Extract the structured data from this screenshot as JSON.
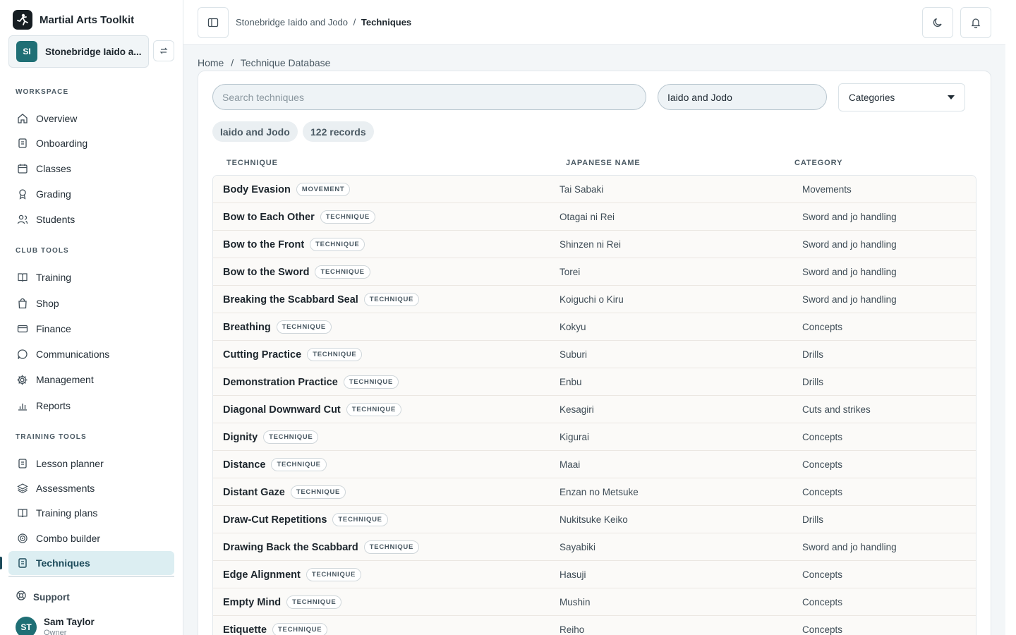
{
  "app": {
    "title": "Martial Arts Toolkit"
  },
  "club": {
    "initials": "SI",
    "name": "Stonebridge Iaido a..."
  },
  "sidebar": {
    "sections": {
      "workspace": "WORKSPACE",
      "club_tools": "CLUB TOOLS",
      "training_tools": "TRAINING TOOLS"
    },
    "workspace_items": [
      {
        "label": "Overview",
        "icon": "home-icon"
      },
      {
        "label": "Onboarding",
        "icon": "clipboard-icon"
      },
      {
        "label": "Classes",
        "icon": "calendar-icon"
      },
      {
        "label": "Grading",
        "icon": "award-icon"
      },
      {
        "label": "Students",
        "icon": "users-icon"
      }
    ],
    "club_items": [
      {
        "label": "Training",
        "icon": "book-icon"
      },
      {
        "label": "Shop",
        "icon": "shopping-bag-icon"
      },
      {
        "label": "Finance",
        "icon": "credit-card-icon"
      },
      {
        "label": "Communications",
        "icon": "message-icon"
      },
      {
        "label": "Management",
        "icon": "gear-icon"
      },
      {
        "label": "Reports",
        "icon": "bar-chart-icon"
      }
    ],
    "training_items": [
      {
        "label": "Lesson planner",
        "icon": "clipboard-icon"
      },
      {
        "label": "Assessments",
        "icon": "layers-icon"
      },
      {
        "label": "Training plans",
        "icon": "book-icon"
      },
      {
        "label": "Combo builder",
        "icon": "target-icon"
      },
      {
        "label": "Techniques",
        "icon": "document-icon",
        "active": true
      }
    ],
    "support": "Support",
    "user": {
      "initials": "ST",
      "name": "Sam Taylor",
      "role": "Owner"
    }
  },
  "topbar": {
    "breadcrumb_parent": "Stonebridge Iaido and Jodo",
    "breadcrumb_sep": "/",
    "breadcrumb_current": "Techniques"
  },
  "main": {
    "breadcrumb_home": "Home",
    "breadcrumb_sep": "/",
    "breadcrumb_current": "Technique Database",
    "search_placeholder": "Search techniques",
    "style_filter": "Iaido and Jodo",
    "category_select": "Categories",
    "chips": {
      "style": "Iaido and Jodo",
      "count": "122 records"
    },
    "columns": {
      "technique": "TECHNIQUE",
      "japanese": "JAPANESE NAME",
      "category": "CATEGORY"
    },
    "rows": [
      {
        "name": "Body Evasion",
        "type": "MOVEMENT",
        "japanese": "Tai Sabaki",
        "category": "Movements"
      },
      {
        "name": "Bow to Each Other",
        "type": "TECHNIQUE",
        "japanese": "Otagai ni Rei",
        "category": "Sword and jo handling"
      },
      {
        "name": "Bow to the Front",
        "type": "TECHNIQUE",
        "japanese": "Shinzen ni Rei",
        "category": "Sword and jo handling"
      },
      {
        "name": "Bow to the Sword",
        "type": "TECHNIQUE",
        "japanese": "Torei",
        "category": "Sword and jo handling"
      },
      {
        "name": "Breaking the Scabbard Seal",
        "type": "TECHNIQUE",
        "japanese": "Koiguchi o Kiru",
        "category": "Sword and jo handling"
      },
      {
        "name": "Breathing",
        "type": "TECHNIQUE",
        "japanese": "Kokyu",
        "category": "Concepts"
      },
      {
        "name": "Cutting Practice",
        "type": "TECHNIQUE",
        "japanese": "Suburi",
        "category": "Drills"
      },
      {
        "name": "Demonstration Practice",
        "type": "TECHNIQUE",
        "japanese": "Enbu",
        "category": "Drills"
      },
      {
        "name": "Diagonal Downward Cut",
        "type": "TECHNIQUE",
        "japanese": "Kesagiri",
        "category": "Cuts and strikes"
      },
      {
        "name": "Dignity",
        "type": "TECHNIQUE",
        "japanese": "Kigurai",
        "category": "Concepts"
      },
      {
        "name": "Distance",
        "type": "TECHNIQUE",
        "japanese": "Maai",
        "category": "Concepts"
      },
      {
        "name": "Distant Gaze",
        "type": "TECHNIQUE",
        "japanese": "Enzan no Metsuke",
        "category": "Concepts"
      },
      {
        "name": "Draw-Cut Repetitions",
        "type": "TECHNIQUE",
        "japanese": "Nukitsuke Keiko",
        "category": "Drills"
      },
      {
        "name": "Drawing Back the Scabbard",
        "type": "TECHNIQUE",
        "japanese": "Sayabiki",
        "category": "Sword and jo handling"
      },
      {
        "name": "Edge Alignment",
        "type": "TECHNIQUE",
        "japanese": "Hasuji",
        "category": "Concepts"
      },
      {
        "name": "Empty Mind",
        "type": "TECHNIQUE",
        "japanese": "Mushin",
        "category": "Concepts"
      },
      {
        "name": "Etiquette",
        "type": "TECHNIQUE",
        "japanese": "Reiho",
        "category": "Concepts"
      }
    ]
  }
}
